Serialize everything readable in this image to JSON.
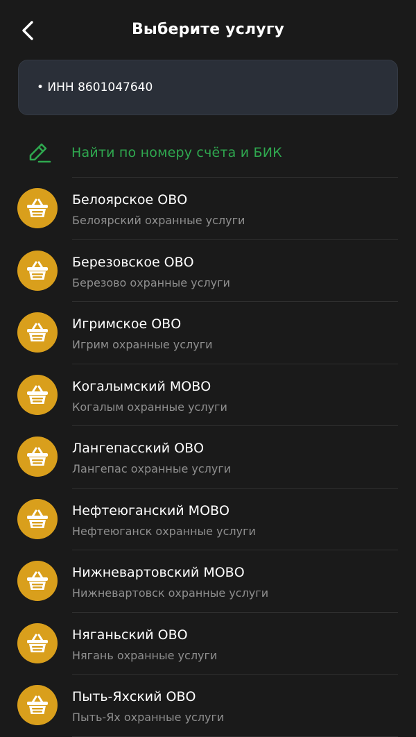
{
  "header": {
    "title": "Выберите услугу",
    "back_icon": "chevron-left-icon"
  },
  "filter": {
    "chip": "• ИНН 8601047640"
  },
  "find_link": {
    "label": "Найти по номеру счёта и БИК",
    "icon": "pencil-icon",
    "color": "#2fa84f"
  },
  "colors": {
    "background": "#1a1a1a",
    "card": "#2a2f38",
    "avatar": "#d99f1c",
    "subtitle": "#8f8f8f"
  },
  "services": [
    {
      "title": "Белоярское ОВО",
      "subtitle": "Белоярский охранные услуги",
      "icon": "basket-icon"
    },
    {
      "title": "Березовское ОВО",
      "subtitle": "Березово охранные услуги",
      "icon": "basket-icon"
    },
    {
      "title": "Игримское ОВО",
      "subtitle": "Игрим охранные услуги",
      "icon": "basket-icon"
    },
    {
      "title": "Когалымский МОВО",
      "subtitle": "Когалым охранные услуги",
      "icon": "basket-icon"
    },
    {
      "title": "Лангепасский ОВО",
      "subtitle": "Лангепас охранные услуги",
      "icon": "basket-icon"
    },
    {
      "title": "Нефтеюганский МОВО",
      "subtitle": "Нефтеюганск охранные услуги",
      "icon": "basket-icon"
    },
    {
      "title": "Нижневартовский МОВО",
      "subtitle": "Нижневартовск охранные услуги",
      "icon": "basket-icon"
    },
    {
      "title": "Няганьский ОВО",
      "subtitle": "Нягань охранные услуги",
      "icon": "basket-icon"
    },
    {
      "title": "Пыть-Яхский ОВО",
      "subtitle": "Пыть-Ях охранные услуги",
      "icon": "basket-icon"
    }
  ]
}
